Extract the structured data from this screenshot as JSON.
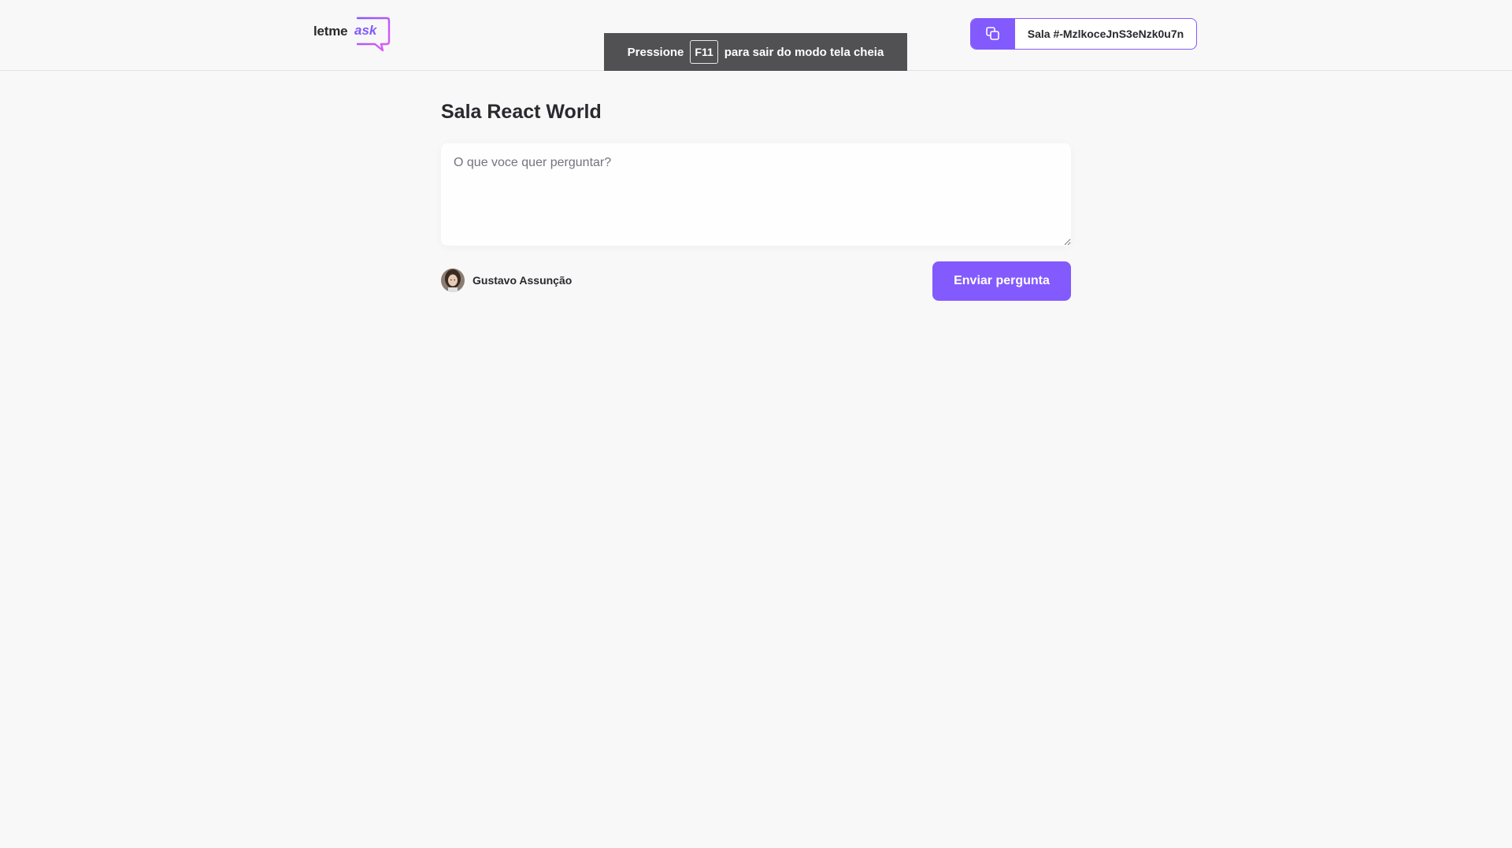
{
  "header": {
    "logo": {
      "text_prefix": "letme",
      "text_accent": "ask"
    },
    "room_code": {
      "label": "Sala #-MzlkoceJnS3eNzk0u7n",
      "icon": "copy-icon"
    }
  },
  "fullscreen_banner": {
    "prefix": "Pressione",
    "key": "F11",
    "suffix": "para sair do modo tela cheia"
  },
  "main": {
    "room_title": "Sala React World",
    "question_placeholder": "O que voce quer perguntar?",
    "question_value": "",
    "user": {
      "name": "Gustavo Assunção",
      "avatar": "avatar-photo"
    },
    "send_button_label": "Enviar pergunta"
  },
  "colors": {
    "accent": "#835afd",
    "background": "#f8f8f8",
    "banner": "#515154",
    "text": "#29292e"
  }
}
